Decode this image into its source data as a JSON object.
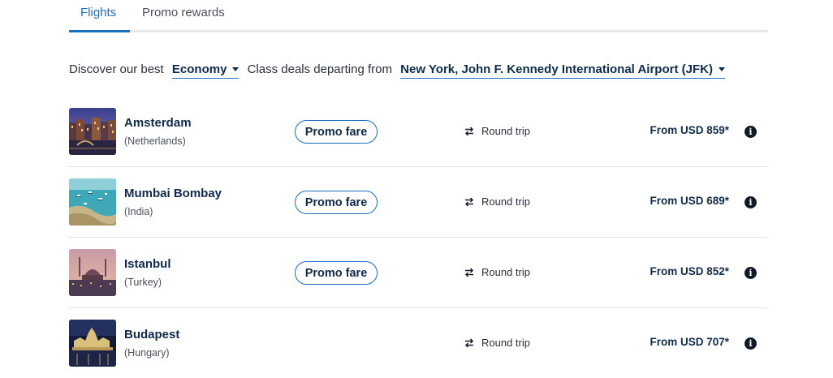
{
  "tabs": [
    {
      "label": "Flights",
      "active": true
    },
    {
      "label": "Promo rewards",
      "active": false
    }
  ],
  "filter": {
    "prefix": "Discover our best",
    "cabin_class": "Economy",
    "middle": "Class deals departing from",
    "departure": "New York, John F. Kennedy International Airport (JFK)"
  },
  "colors": {
    "accent": "#1a6fc4",
    "text_dark": "#0f2a4a",
    "divider": "#e4e6ea"
  },
  "deals": [
    {
      "city": "Amsterdam",
      "country": "(Netherlands)",
      "badge": "Promo fare",
      "trip": "Round trip",
      "price": "From USD 859*",
      "thumbnail": "amsterdam-canal-night"
    },
    {
      "city": "Mumbai Bombay",
      "country": "(India)",
      "badge": "Promo fare",
      "trip": "Round trip",
      "price": "From USD 689*",
      "thumbnail": "mumbai-harbor-boats"
    },
    {
      "city": "Istanbul",
      "country": "(Turkey)",
      "badge": "Promo fare",
      "trip": "Round trip",
      "price": "From USD 852*",
      "thumbnail": "istanbul-mosque-sunset"
    },
    {
      "city": "Budapest",
      "country": "(Hungary)",
      "badge": "",
      "trip": "Round trip",
      "price": "From USD 707*",
      "thumbnail": "budapest-parliament-night"
    }
  ],
  "icons": {
    "trip": "round-trip-arrows-icon",
    "info": "info-icon",
    "dropdown": "chevron-down-icon"
  }
}
